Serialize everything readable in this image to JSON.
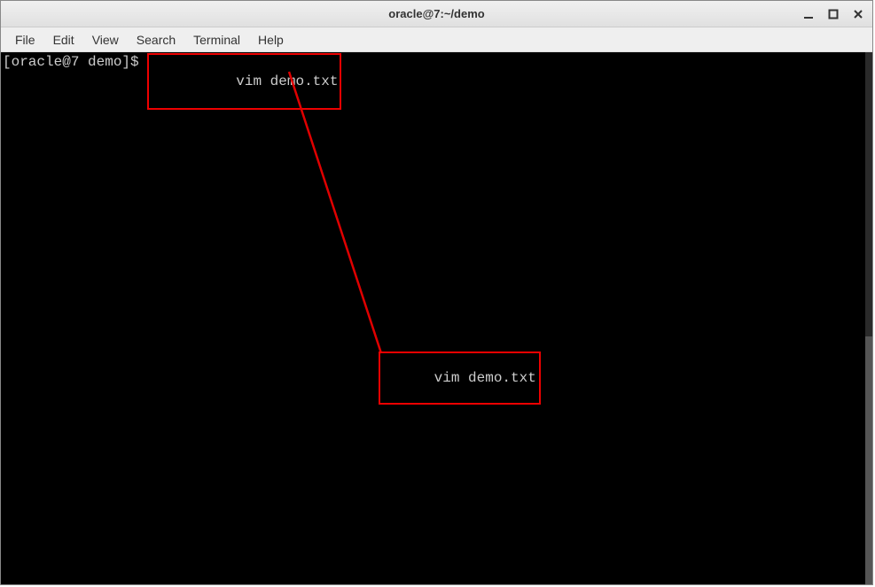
{
  "colors": {
    "annotation": "#e00000"
  },
  "titlebar": {
    "title": "oracle@7:~/demo"
  },
  "menubar": {
    "items": [
      "File",
      "Edit",
      "View",
      "Search",
      "Terminal",
      "Help"
    ]
  },
  "terminal": {
    "prompt": "[oracle@7 demo]$ ",
    "command": "vim demo.txt",
    "callout_text": "vim demo.txt"
  }
}
